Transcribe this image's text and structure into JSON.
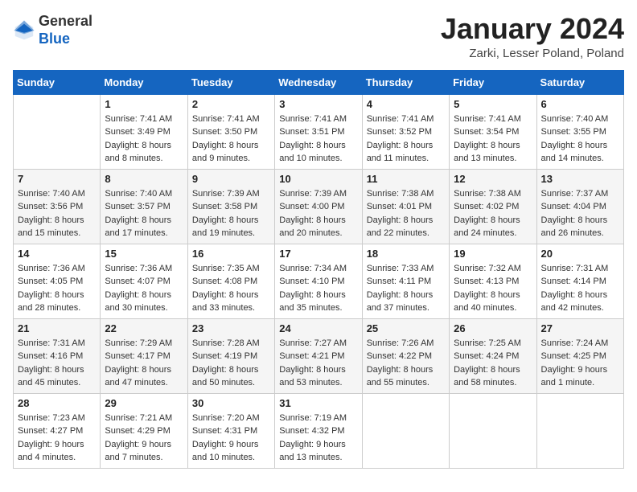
{
  "header": {
    "logo_general": "General",
    "logo_blue": "Blue",
    "month_title": "January 2024",
    "location": "Zarki, Lesser Poland, Poland"
  },
  "days_of_week": [
    "Sunday",
    "Monday",
    "Tuesday",
    "Wednesday",
    "Thursday",
    "Friday",
    "Saturday"
  ],
  "weeks": [
    [
      {
        "day": "",
        "info": ""
      },
      {
        "day": "1",
        "info": "Sunrise: 7:41 AM\nSunset: 3:49 PM\nDaylight: 8 hours\nand 8 minutes."
      },
      {
        "day": "2",
        "info": "Sunrise: 7:41 AM\nSunset: 3:50 PM\nDaylight: 8 hours\nand 9 minutes."
      },
      {
        "day": "3",
        "info": "Sunrise: 7:41 AM\nSunset: 3:51 PM\nDaylight: 8 hours\nand 10 minutes."
      },
      {
        "day": "4",
        "info": "Sunrise: 7:41 AM\nSunset: 3:52 PM\nDaylight: 8 hours\nand 11 minutes."
      },
      {
        "day": "5",
        "info": "Sunrise: 7:41 AM\nSunset: 3:54 PM\nDaylight: 8 hours\nand 13 minutes."
      },
      {
        "day": "6",
        "info": "Sunrise: 7:40 AM\nSunset: 3:55 PM\nDaylight: 8 hours\nand 14 minutes."
      }
    ],
    [
      {
        "day": "7",
        "info": "Sunrise: 7:40 AM\nSunset: 3:56 PM\nDaylight: 8 hours\nand 15 minutes."
      },
      {
        "day": "8",
        "info": "Sunrise: 7:40 AM\nSunset: 3:57 PM\nDaylight: 8 hours\nand 17 minutes."
      },
      {
        "day": "9",
        "info": "Sunrise: 7:39 AM\nSunset: 3:58 PM\nDaylight: 8 hours\nand 19 minutes."
      },
      {
        "day": "10",
        "info": "Sunrise: 7:39 AM\nSunset: 4:00 PM\nDaylight: 8 hours\nand 20 minutes."
      },
      {
        "day": "11",
        "info": "Sunrise: 7:38 AM\nSunset: 4:01 PM\nDaylight: 8 hours\nand 22 minutes."
      },
      {
        "day": "12",
        "info": "Sunrise: 7:38 AM\nSunset: 4:02 PM\nDaylight: 8 hours\nand 24 minutes."
      },
      {
        "day": "13",
        "info": "Sunrise: 7:37 AM\nSunset: 4:04 PM\nDaylight: 8 hours\nand 26 minutes."
      }
    ],
    [
      {
        "day": "14",
        "info": "Sunrise: 7:36 AM\nSunset: 4:05 PM\nDaylight: 8 hours\nand 28 minutes."
      },
      {
        "day": "15",
        "info": "Sunrise: 7:36 AM\nSunset: 4:07 PM\nDaylight: 8 hours\nand 30 minutes."
      },
      {
        "day": "16",
        "info": "Sunrise: 7:35 AM\nSunset: 4:08 PM\nDaylight: 8 hours\nand 33 minutes."
      },
      {
        "day": "17",
        "info": "Sunrise: 7:34 AM\nSunset: 4:10 PM\nDaylight: 8 hours\nand 35 minutes."
      },
      {
        "day": "18",
        "info": "Sunrise: 7:33 AM\nSunset: 4:11 PM\nDaylight: 8 hours\nand 37 minutes."
      },
      {
        "day": "19",
        "info": "Sunrise: 7:32 AM\nSunset: 4:13 PM\nDaylight: 8 hours\nand 40 minutes."
      },
      {
        "day": "20",
        "info": "Sunrise: 7:31 AM\nSunset: 4:14 PM\nDaylight: 8 hours\nand 42 minutes."
      }
    ],
    [
      {
        "day": "21",
        "info": "Sunrise: 7:31 AM\nSunset: 4:16 PM\nDaylight: 8 hours\nand 45 minutes."
      },
      {
        "day": "22",
        "info": "Sunrise: 7:29 AM\nSunset: 4:17 PM\nDaylight: 8 hours\nand 47 minutes."
      },
      {
        "day": "23",
        "info": "Sunrise: 7:28 AM\nSunset: 4:19 PM\nDaylight: 8 hours\nand 50 minutes."
      },
      {
        "day": "24",
        "info": "Sunrise: 7:27 AM\nSunset: 4:21 PM\nDaylight: 8 hours\nand 53 minutes."
      },
      {
        "day": "25",
        "info": "Sunrise: 7:26 AM\nSunset: 4:22 PM\nDaylight: 8 hours\nand 55 minutes."
      },
      {
        "day": "26",
        "info": "Sunrise: 7:25 AM\nSunset: 4:24 PM\nDaylight: 8 hours\nand 58 minutes."
      },
      {
        "day": "27",
        "info": "Sunrise: 7:24 AM\nSunset: 4:25 PM\nDaylight: 9 hours\nand 1 minute."
      }
    ],
    [
      {
        "day": "28",
        "info": "Sunrise: 7:23 AM\nSunset: 4:27 PM\nDaylight: 9 hours\nand 4 minutes."
      },
      {
        "day": "29",
        "info": "Sunrise: 7:21 AM\nSunset: 4:29 PM\nDaylight: 9 hours\nand 7 minutes."
      },
      {
        "day": "30",
        "info": "Sunrise: 7:20 AM\nSunset: 4:31 PM\nDaylight: 9 hours\nand 10 minutes."
      },
      {
        "day": "31",
        "info": "Sunrise: 7:19 AM\nSunset: 4:32 PM\nDaylight: 9 hours\nand 13 minutes."
      },
      {
        "day": "",
        "info": ""
      },
      {
        "day": "",
        "info": ""
      },
      {
        "day": "",
        "info": ""
      }
    ]
  ]
}
